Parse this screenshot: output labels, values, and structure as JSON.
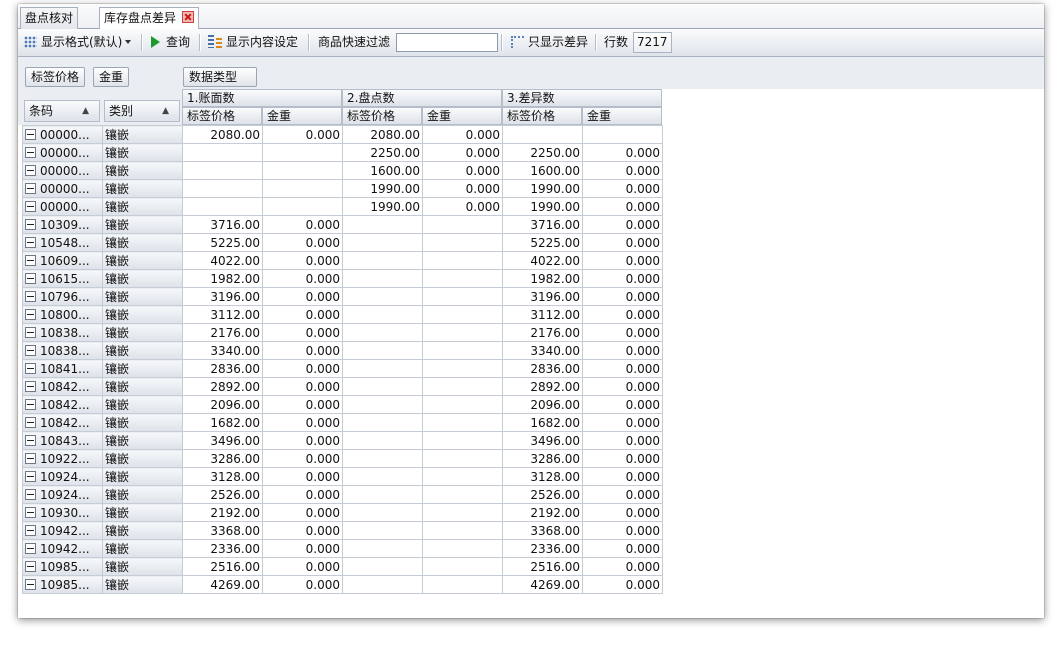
{
  "tabs": [
    {
      "label": "盘点核对",
      "active": false
    },
    {
      "label": "库存盘点差异",
      "active": true
    }
  ],
  "toolbar": {
    "display_format": "显示格式(默认)",
    "query": "查询",
    "display_settings": "显示内容设定",
    "quick_filter_label": "商品快速过滤",
    "quick_filter_value": "",
    "show_diff_only": "只显示差异",
    "row_count_label": "行数",
    "row_count_value": "7217"
  },
  "pivot": {
    "column_fields": [
      "标签价格",
      "金重"
    ],
    "data_type_field": "数据类型",
    "row_fields": [
      "条码",
      "类别"
    ],
    "groups": [
      "1.账面数",
      "2.盘点数",
      "3.差异数"
    ],
    "sub_columns": [
      "标签价格",
      "金重"
    ]
  },
  "rows": [
    {
      "code": "00000...",
      "cat": "镶嵌",
      "v": [
        "2080.00",
        "0.000",
        "2080.00",
        "0.000",
        "",
        ""
      ]
    },
    {
      "code": "00000...",
      "cat": "镶嵌",
      "v": [
        "",
        "",
        "2250.00",
        "0.000",
        "2250.00",
        "0.000"
      ]
    },
    {
      "code": "00000...",
      "cat": "镶嵌",
      "v": [
        "",
        "",
        "1600.00",
        "0.000",
        "1600.00",
        "0.000"
      ]
    },
    {
      "code": "00000...",
      "cat": "镶嵌",
      "v": [
        "",
        "",
        "1990.00",
        "0.000",
        "1990.00",
        "0.000"
      ]
    },
    {
      "code": "00000...",
      "cat": "镶嵌",
      "v": [
        "",
        "",
        "1990.00",
        "0.000",
        "1990.00",
        "0.000"
      ]
    },
    {
      "code": "10309...",
      "cat": "镶嵌",
      "v": [
        "3716.00",
        "0.000",
        "",
        "",
        "3716.00",
        "0.000"
      ]
    },
    {
      "code": "10548...",
      "cat": "镶嵌",
      "v": [
        "5225.00",
        "0.000",
        "",
        "",
        "5225.00",
        "0.000"
      ]
    },
    {
      "code": "10609...",
      "cat": "镶嵌",
      "v": [
        "4022.00",
        "0.000",
        "",
        "",
        "4022.00",
        "0.000"
      ]
    },
    {
      "code": "10615...",
      "cat": "镶嵌",
      "v": [
        "1982.00",
        "0.000",
        "",
        "",
        "1982.00",
        "0.000"
      ]
    },
    {
      "code": "10796...",
      "cat": "镶嵌",
      "v": [
        "3196.00",
        "0.000",
        "",
        "",
        "3196.00",
        "0.000"
      ]
    },
    {
      "code": "10800...",
      "cat": "镶嵌",
      "v": [
        "3112.00",
        "0.000",
        "",
        "",
        "3112.00",
        "0.000"
      ]
    },
    {
      "code": "10838...",
      "cat": "镶嵌",
      "v": [
        "2176.00",
        "0.000",
        "",
        "",
        "2176.00",
        "0.000"
      ]
    },
    {
      "code": "10838...",
      "cat": "镶嵌",
      "v": [
        "3340.00",
        "0.000",
        "",
        "",
        "3340.00",
        "0.000"
      ]
    },
    {
      "code": "10841...",
      "cat": "镶嵌",
      "v": [
        "2836.00",
        "0.000",
        "",
        "",
        "2836.00",
        "0.000"
      ]
    },
    {
      "code": "10842...",
      "cat": "镶嵌",
      "v": [
        "2892.00",
        "0.000",
        "",
        "",
        "2892.00",
        "0.000"
      ]
    },
    {
      "code": "10842...",
      "cat": "镶嵌",
      "v": [
        "2096.00",
        "0.000",
        "",
        "",
        "2096.00",
        "0.000"
      ]
    },
    {
      "code": "10842...",
      "cat": "镶嵌",
      "v": [
        "1682.00",
        "0.000",
        "",
        "",
        "1682.00",
        "0.000"
      ]
    },
    {
      "code": "10843...",
      "cat": "镶嵌",
      "v": [
        "3496.00",
        "0.000",
        "",
        "",
        "3496.00",
        "0.000"
      ]
    },
    {
      "code": "10922...",
      "cat": "镶嵌",
      "v": [
        "3286.00",
        "0.000",
        "",
        "",
        "3286.00",
        "0.000"
      ]
    },
    {
      "code": "10924...",
      "cat": "镶嵌",
      "v": [
        "3128.00",
        "0.000",
        "",
        "",
        "3128.00",
        "0.000"
      ]
    },
    {
      "code": "10924...",
      "cat": "镶嵌",
      "v": [
        "2526.00",
        "0.000",
        "",
        "",
        "2526.00",
        "0.000"
      ]
    },
    {
      "code": "10930...",
      "cat": "镶嵌",
      "v": [
        "2192.00",
        "0.000",
        "",
        "",
        "2192.00",
        "0.000"
      ]
    },
    {
      "code": "10942...",
      "cat": "镶嵌",
      "v": [
        "3368.00",
        "0.000",
        "",
        "",
        "3368.00",
        "0.000"
      ]
    },
    {
      "code": "10942...",
      "cat": "镶嵌",
      "v": [
        "2336.00",
        "0.000",
        "",
        "",
        "2336.00",
        "0.000"
      ]
    },
    {
      "code": "10985...",
      "cat": "镶嵌",
      "v": [
        "2516.00",
        "0.000",
        "",
        "",
        "2516.00",
        "0.000"
      ]
    },
    {
      "code": "10985...",
      "cat": "镶嵌",
      "v": [
        "4269.00",
        "0.000",
        "",
        "",
        "4269.00",
        "0.000"
      ]
    }
  ]
}
